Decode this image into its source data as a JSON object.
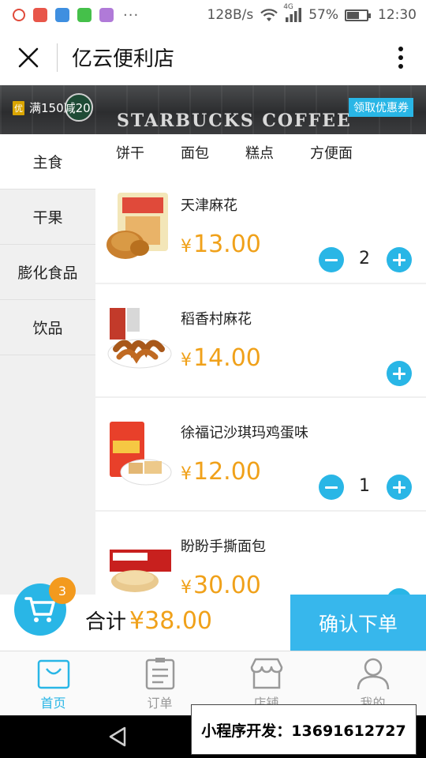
{
  "status_bar": {
    "speed": "128B/s",
    "network": "4G",
    "battery": "57%",
    "battery_level": 0.57,
    "time": "12:30",
    "more": "···"
  },
  "nav": {
    "title": "亿云便利店"
  },
  "banner": {
    "promo_badge": "优",
    "promo_text": "满150减20",
    "coupon_button": "领取优惠券",
    "background_text": "STARBUCKS COFFEE"
  },
  "categories": [
    "主食",
    "干果",
    "膨化食品",
    "饮品"
  ],
  "subcategories": [
    "饼干",
    "面包",
    "糕点",
    "方便面"
  ],
  "products": [
    {
      "name": "天津麻花",
      "currency": "¥",
      "price": "13.00",
      "quantity": "2"
    },
    {
      "name": "稻香村麻花",
      "currency": "¥",
      "price": "14.00",
      "quantity": ""
    },
    {
      "name": "徐福记沙琪玛鸡蛋味",
      "currency": "¥",
      "price": "12.00",
      "quantity": "1"
    },
    {
      "name": "盼盼手撕面包",
      "currency": "¥",
      "price": "30.00",
      "quantity": ""
    }
  ],
  "cart": {
    "badge": "3",
    "total_label": "合计",
    "total_value": "¥38.00",
    "confirm_button": "确认下单"
  },
  "tabs": [
    {
      "label": "首页",
      "active": true
    },
    {
      "label": "订单",
      "active": false
    },
    {
      "label": "店铺",
      "active": false
    },
    {
      "label": "我的",
      "active": false
    }
  ],
  "watermark": "小程序开发：13691612727",
  "colors": {
    "accent": "#29b6e6",
    "price": "#f0a11a",
    "badge": "#f39a1e"
  }
}
